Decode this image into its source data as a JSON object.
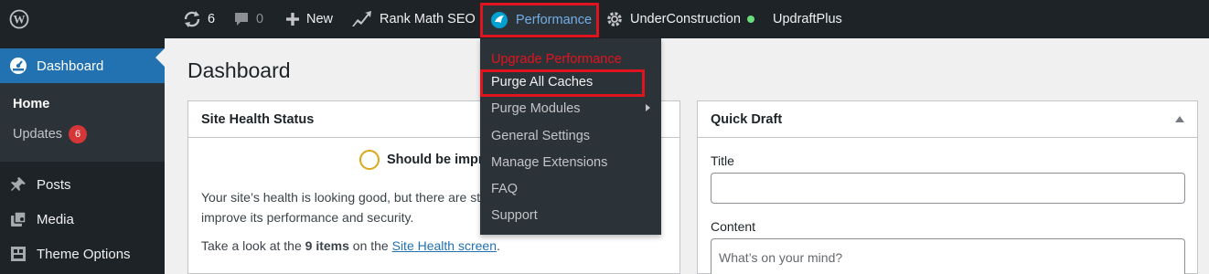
{
  "adminbar": {
    "updates_count": "6",
    "comments_count": "0",
    "new_label": "New",
    "rankmath_label": "Rank Math SEO",
    "performance_label": "Performance",
    "underconstruction_label": "UnderConstruction",
    "updraft_label": "UpdraftPlus",
    "status_dot_color": "#68de7c"
  },
  "performance_menu": {
    "items": [
      {
        "label": "Upgrade Performance"
      },
      {
        "label": "Purge All Caches"
      },
      {
        "label": "Purge Modules"
      },
      {
        "label": "General Settings"
      },
      {
        "label": "Manage Extensions"
      },
      {
        "label": "FAQ"
      },
      {
        "label": "Support"
      }
    ]
  },
  "sidebar": {
    "dashboard_label": "Dashboard",
    "home_label": "Home",
    "updates_label": "Updates",
    "updates_badge": "6",
    "items": [
      {
        "label": "Posts",
        "icon": "pushpin-icon"
      },
      {
        "label": "Media",
        "icon": "media-icon"
      },
      {
        "label": "Theme Options",
        "icon": "theme-options-icon"
      }
    ]
  },
  "main": {
    "page_title": "Dashboard",
    "site_health": {
      "title": "Site Health Status",
      "status": "Should be impro",
      "description": "Your site’s health is looking good, but there are still some things you can do to improve its performance and security.",
      "look_prefix": "Take a look at the",
      "items_count": "9 items",
      "look_middle": "on the",
      "link_text": "Site Health screen",
      "look_suffix": "."
    },
    "quick_draft": {
      "title": "Quick Draft",
      "title_label": "Title",
      "content_label": "Content",
      "content_placeholder": "What’s on your mind?"
    }
  },
  "colors": {
    "adminbar_bg": "#1d2327",
    "accent": "#2271b1",
    "highlight_border": "#e0141e",
    "warning_ring": "#dba617"
  }
}
